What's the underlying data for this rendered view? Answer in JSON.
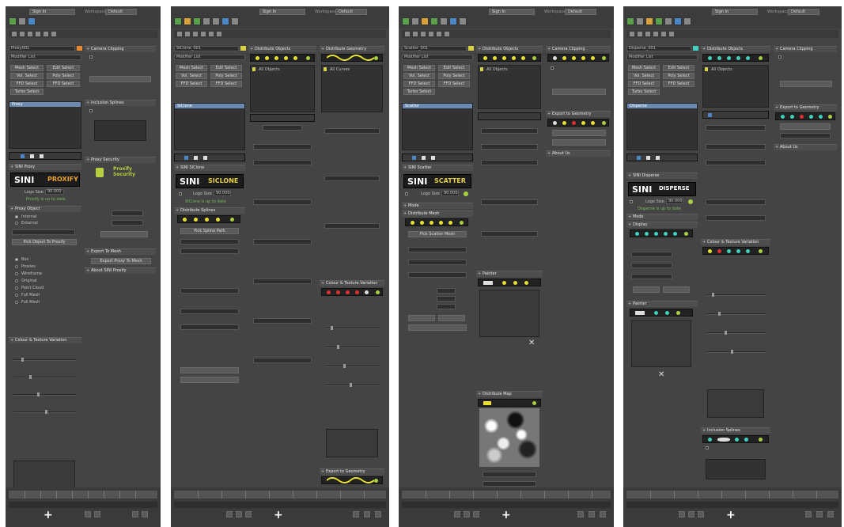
{
  "app": {
    "sign_in": "Sign In",
    "workspaces_label": "Workspaces:",
    "workspace_value": "Default"
  },
  "panels": [
    {
      "object_name": "Proxy001",
      "modifier_list": "Modifier List",
      "buttons": [
        "Mesh Select",
        "Edit Select",
        "Vol. Select",
        "Poly Select",
        "FFD Select",
        "FFD Select",
        "Turbo Select"
      ],
      "list_item": "Proxy",
      "rollouts": [
        "SINI Proxy",
        "Proxy Object",
        "Colour & Texture Variation",
        "Camera Clipping",
        "Inclusion Splines",
        "Proxy Security",
        "Export To Mesh",
        "About SINI Proxify"
      ],
      "logo_tag": "PROXIFY",
      "size_label": "Logo Size",
      "size_value": "90.000",
      "green_note": "Proxify is up to date",
      "options": [
        "Internal",
        "External"
      ],
      "pick_button": "Pick Object To Proxify",
      "display_items": [
        "Box",
        "Proxies",
        "Wireframe",
        "Original",
        "Point Cloud",
        "Full Mesh",
        "Full Mesh"
      ],
      "security_text": "Proxify Security",
      "export_button": "Export Proxy To Mesh"
    },
    {
      "object_name": "SIClone_001",
      "modifier_list": "Modifier List",
      "buttons": [
        "Mesh Select",
        "Edit Select",
        "Vol. Select",
        "Poly Select",
        "FFD Select",
        "FFD Select"
      ],
      "list_item": "SIClone",
      "rollouts": [
        "SINI SIClone",
        "Distribute Splines",
        "Distribute Objects",
        "Distribute Geometry",
        "Colour & Texture Variation",
        "Export to Geometry"
      ],
      "logo_tag": "SICLONE",
      "size_label": "Logo Size",
      "size_value": "90.000",
      "green_note": "SIClone is up to date",
      "spline_button": "Pick Spline Path",
      "list_label": "All Objects",
      "list_label2": "All Curves"
    },
    {
      "object_name": "Scatter_001",
      "modifier_list": "Modifier List",
      "buttons": [
        "Mesh Select",
        "Edit Select",
        "Vol. Select",
        "Poly Select",
        "FFD Select",
        "FFD Select",
        "Turbo Select"
      ],
      "list_item": "Scatter",
      "rollouts": [
        "SINI Scatter",
        "Mode",
        "Distribute Mesh",
        "Distribute Objects",
        "Camera Clipping",
        "Export to Geometry",
        "About Us",
        "Painter",
        "Distribute Map"
      ],
      "logo_tag": "SCATTER",
      "size_label": "Logo Size",
      "size_value": "90.000",
      "pick_button": "Pick Scatter Mesh",
      "list_label": "All Objects"
    },
    {
      "object_name": "Disperse_001",
      "modifier_list": "Modifier List",
      "buttons": [
        "Mesh Select",
        "Edit Select",
        "Vol. Select",
        "Poly Select",
        "FFD Select",
        "FFD Select",
        "Turbo Select"
      ],
      "list_item": "Disperse",
      "rollouts": [
        "SINI Disperse",
        "Mode",
        "Display",
        "Colour & Texture Variation",
        "Painter",
        "Inclusion Splines",
        "Distribute Objects",
        "Camera Clipping",
        "Export to Geometry",
        "About Us"
      ],
      "logo_tag": "DISPERSE",
      "size_label": "Logo Size",
      "size_value": "90.000",
      "green_note": "Disperse is up to date",
      "list_label": "All Objects"
    }
  ]
}
